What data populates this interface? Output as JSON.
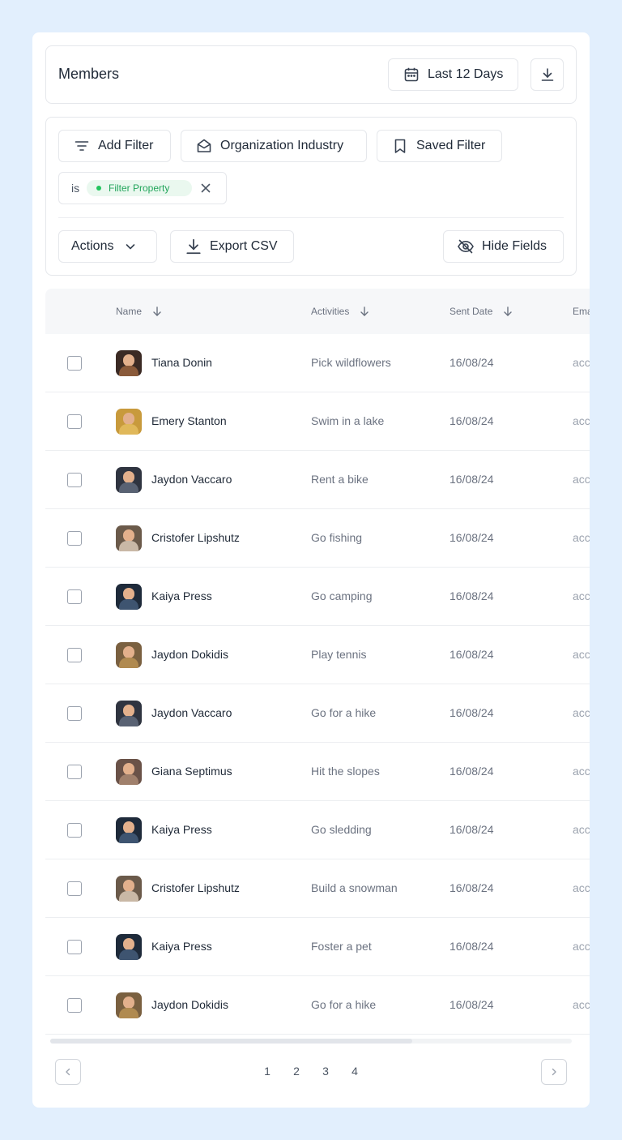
{
  "header": {
    "title": "Members",
    "date_range_label": "Last 12 Days"
  },
  "filters": {
    "add_filter_label": "Add Filter",
    "org_industry_label": "Organization Industry",
    "saved_filter_label": "Saved Filter",
    "active_filter": {
      "operator": "is",
      "value": "Filter Property"
    },
    "actions_label": "Actions",
    "export_label": "Export CSV",
    "hide_fields_label": "Hide Fields"
  },
  "table": {
    "columns": [
      "Name",
      "Activities",
      "Sent Date",
      "Email"
    ],
    "rows": [
      {
        "name": "Tiana Donin",
        "activity": "Pick wildflowers",
        "date": "16/08/24",
        "email": "acc"
      },
      {
        "name": "Emery Stanton",
        "activity": "Swim in a lake",
        "date": "16/08/24",
        "email": "acc"
      },
      {
        "name": "Jaydon Vaccaro",
        "activity": "Rent a bike",
        "date": "16/08/24",
        "email": "acc"
      },
      {
        "name": "Cristofer Lipshutz",
        "activity": "Go fishing",
        "date": "16/08/24",
        "email": "acc"
      },
      {
        "name": "Kaiya Press",
        "activity": "Go camping",
        "date": "16/08/24",
        "email": "acc"
      },
      {
        "name": "Jaydon Dokidis",
        "activity": "Play tennis",
        "date": "16/08/24",
        "email": "acc"
      },
      {
        "name": "Jaydon Vaccaro",
        "activity": "Go for a hike",
        "date": "16/08/24",
        "email": "acc"
      },
      {
        "name": "Giana Septimus",
        "activity": "Hit the slopes",
        "date": "16/08/24",
        "email": "acc"
      },
      {
        "name": "Kaiya Press",
        "activity": "Go sledding",
        "date": "16/08/24",
        "email": "acc"
      },
      {
        "name": "Cristofer Lipshutz",
        "activity": "Build a snowman",
        "date": "16/08/24",
        "email": "acc"
      },
      {
        "name": "Kaiya Press",
        "activity": "Foster a pet",
        "date": "16/08/24",
        "email": "acc"
      },
      {
        "name": "Jaydon Dokidis",
        "activity": "Go for a hike",
        "date": "16/08/24",
        "email": "acc"
      }
    ]
  },
  "pagination": {
    "pages": [
      "1",
      "2",
      "3",
      "4"
    ]
  },
  "colors": {
    "page_bg": "#e2effd",
    "filter_green": "#22a55b",
    "border": "#e5e7eb"
  }
}
